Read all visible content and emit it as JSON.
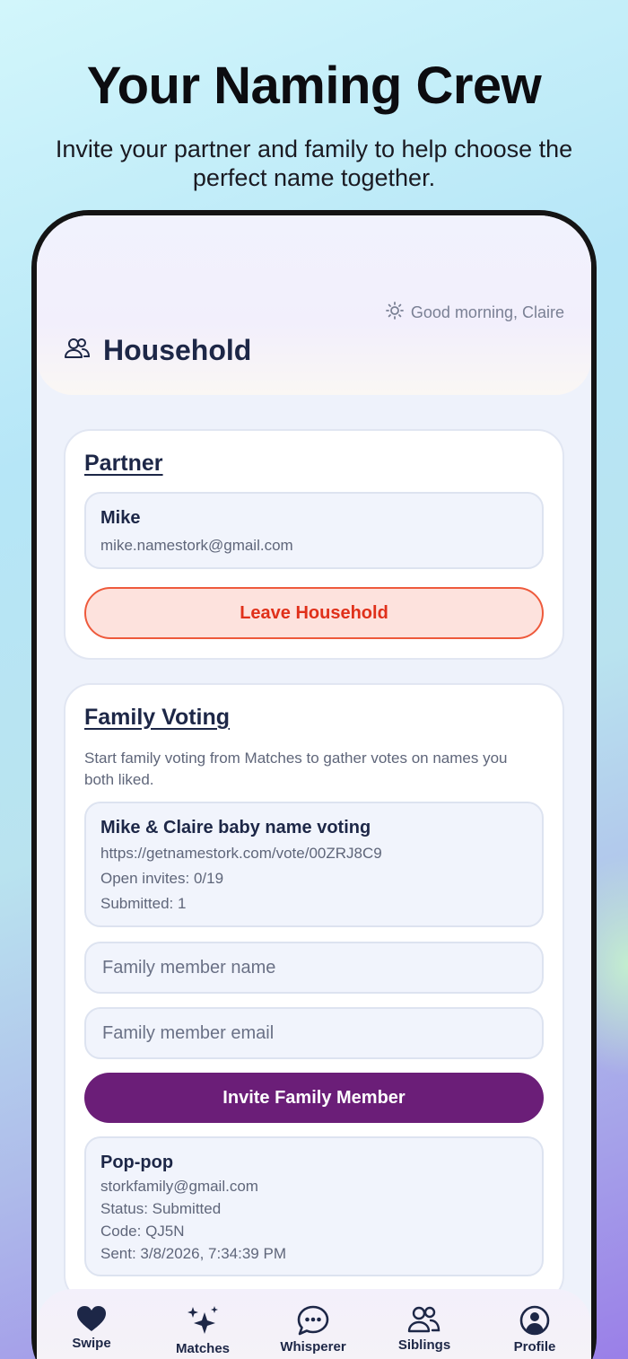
{
  "promo": {
    "headline": "Your Naming Crew",
    "subhead": "Invite your partner and family to help choose the perfect name together."
  },
  "header": {
    "greeting": "Good morning, Claire",
    "title": "Household",
    "greeting_icon": "sun-icon",
    "title_icon": "people-icon"
  },
  "partner_card": {
    "title": "Partner",
    "partner_name": "Mike",
    "partner_email": "mike.namestork@gmail.com",
    "leave_button": "Leave Household"
  },
  "family_card": {
    "title": "Family Voting",
    "description": "Start family voting from Matches to gather votes on names you both liked.",
    "session": {
      "title": "Mike & Claire baby name voting",
      "url": "https://getnamestork.com/vote/00ZRJ8C9",
      "open_invites": "Open invites: 0/19",
      "submitted": "Submitted: 1"
    },
    "name_placeholder": "Family member name",
    "email_placeholder": "Family member email",
    "invite_button": "Invite Family Member",
    "member": {
      "name": "Pop-pop",
      "email": "storkfamily@gmail.com",
      "status": "Status: Submitted",
      "code": "Code: QJ5N",
      "sent": "Sent: 3/8/2026, 7:34:39 PM"
    }
  },
  "tabs": [
    {
      "label": "Swipe",
      "icon": "heart-icon"
    },
    {
      "label": "Matches",
      "icon": "sparkles-icon"
    },
    {
      "label": "Whisperer",
      "icon": "chat-bubble-icon"
    },
    {
      "label": "Siblings",
      "icon": "people-icon"
    },
    {
      "label": "Profile",
      "icon": "user-circle-icon"
    }
  ],
  "colors": {
    "primary_text": "#1d2747",
    "invite_button": "#6b1e78",
    "leave_button_text": "#e0301a",
    "leave_button_bg": "#fde2dd"
  }
}
